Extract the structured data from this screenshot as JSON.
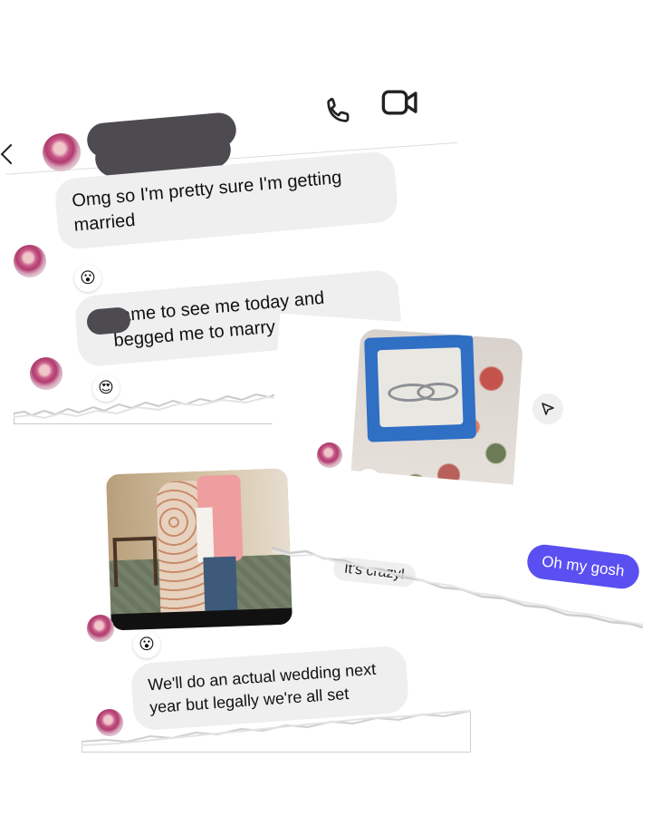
{
  "messages": {
    "m1": "Omg so I'm pretty sure I'm getting\nmarried",
    "m2": "came to see me today and\nbegged me to marry him",
    "m3": "We'll do an actual wedding next\nyear but legally we're all set",
    "sent": "Oh my gosh",
    "partial": "It's crazy!"
  },
  "reactions": {
    "r1": "😮",
    "r2": "😍",
    "r3": "😮",
    "r4": "😮"
  },
  "icons": {
    "back": "chevron-left-icon",
    "call": "phone-icon",
    "video": "video-camera-icon",
    "share": "send-icon"
  },
  "colors": {
    "sent_bubble": "#5a4ff0",
    "received_bubble": "#efefef",
    "redaction": "#4d4b50"
  }
}
